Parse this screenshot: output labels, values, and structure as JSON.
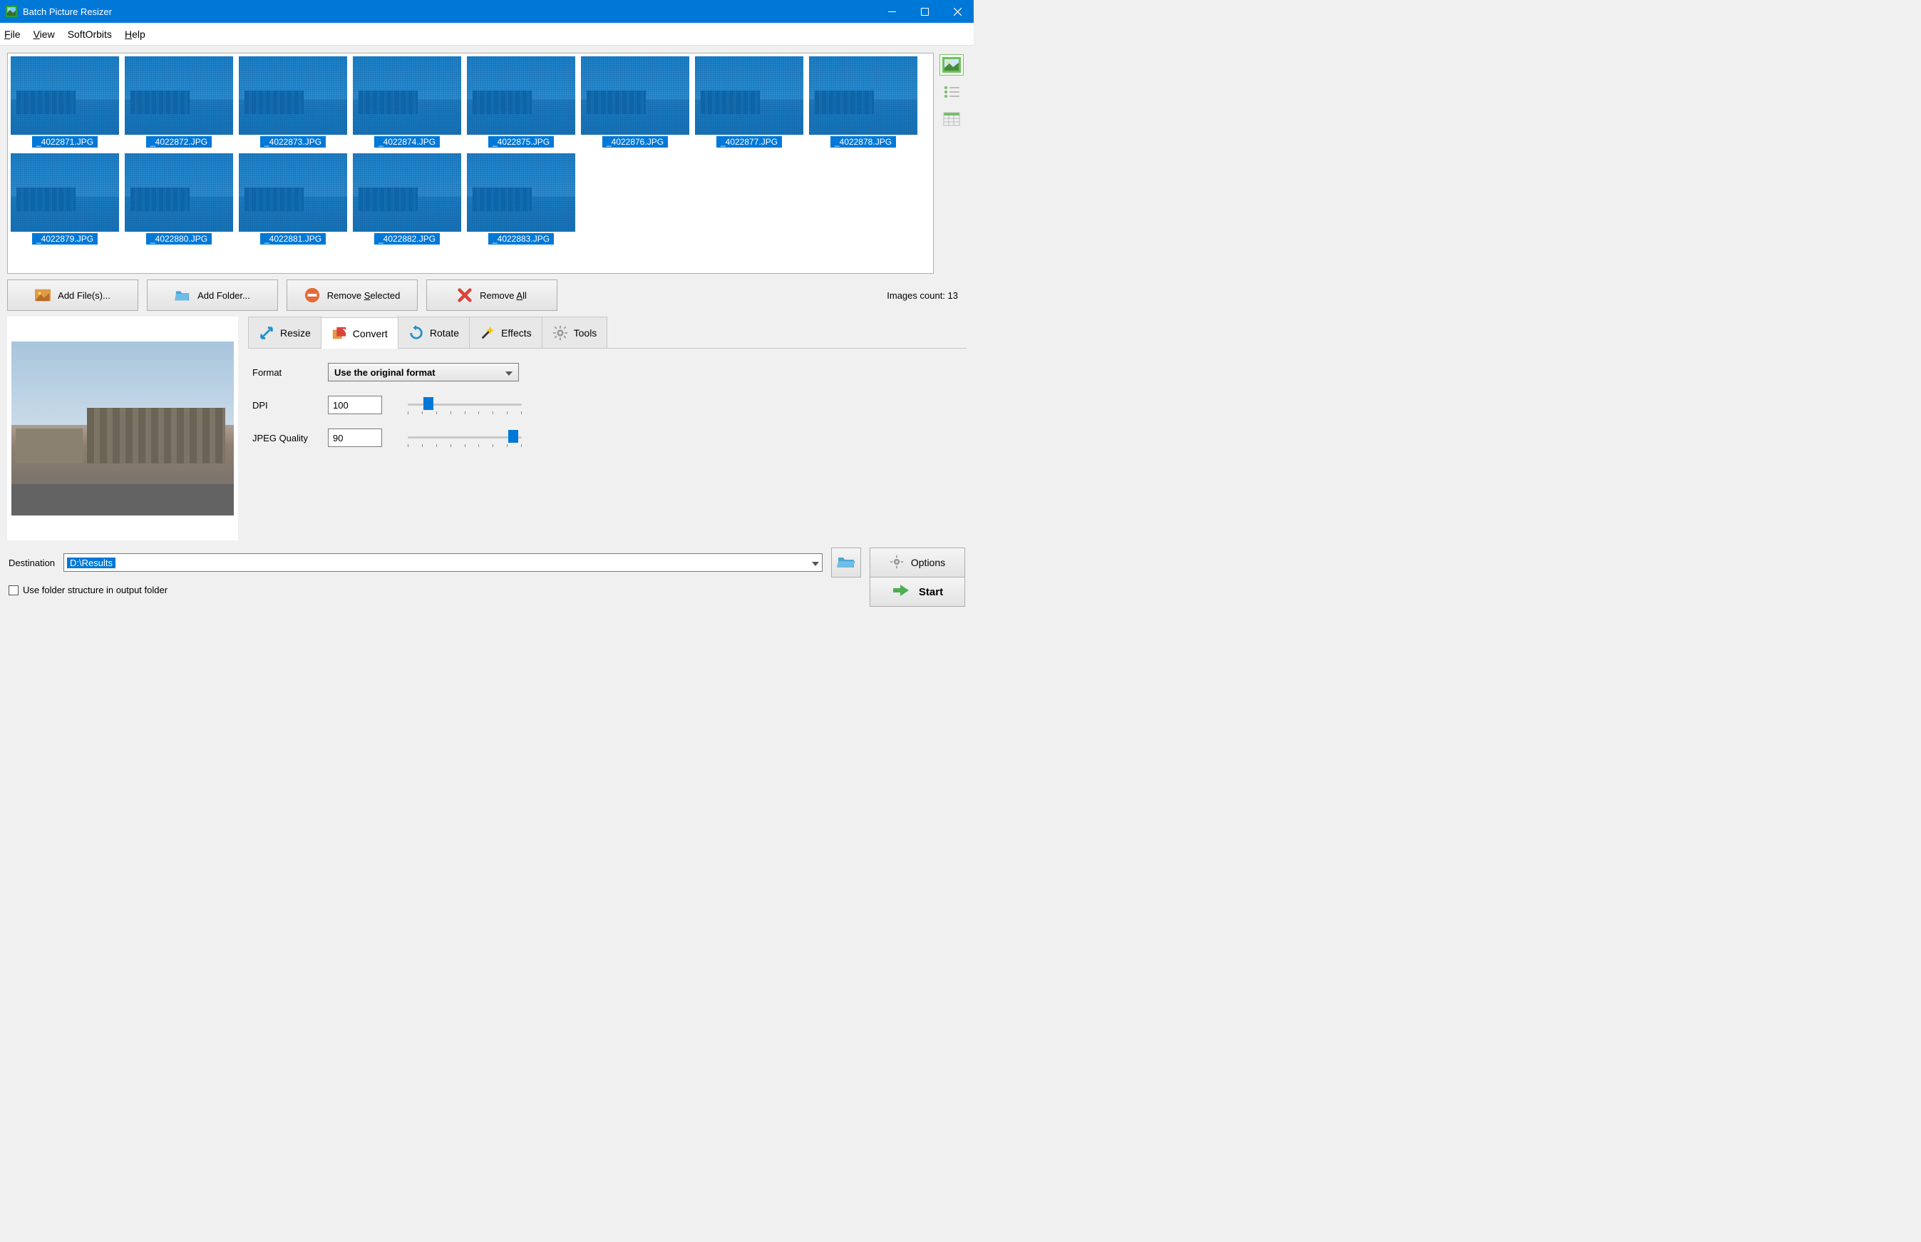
{
  "window": {
    "title": "Batch Picture Resizer"
  },
  "menu": {
    "file": "File",
    "view": "View",
    "softorbits": "SoftOrbits",
    "help": "Help"
  },
  "thumbnails": [
    "_4022871.JPG",
    "_4022872.JPG",
    "_4022873.JPG",
    "_4022874.JPG",
    "_4022875.JPG",
    "_4022876.JPG",
    "_4022877.JPG",
    "_4022878.JPG",
    "_4022879.JPG",
    "_4022880.JPG",
    "_4022881.JPG",
    "_4022882.JPG",
    "_4022883.JPG"
  ],
  "toolbar": {
    "add_files": "Add File(s)...",
    "add_folder": "Add Folder...",
    "remove_selected": "Remove Selected",
    "remove_all": "Remove All",
    "images_count_label": "Images count: 13"
  },
  "tabs": {
    "resize": "Resize",
    "convert": "Convert",
    "rotate": "Rotate",
    "effects": "Effects",
    "tools": "Tools"
  },
  "convert": {
    "format_label": "Format",
    "format_value": "Use the original format",
    "dpi_label": "DPI",
    "dpi_value": "100",
    "jpeg_label": "JPEG Quality",
    "jpeg_value": "90"
  },
  "footer": {
    "destination_label": "Destination",
    "destination_value": "D:\\Results",
    "use_folder_structure": "Use folder structure in output folder",
    "options": "Options",
    "start": "Start"
  }
}
